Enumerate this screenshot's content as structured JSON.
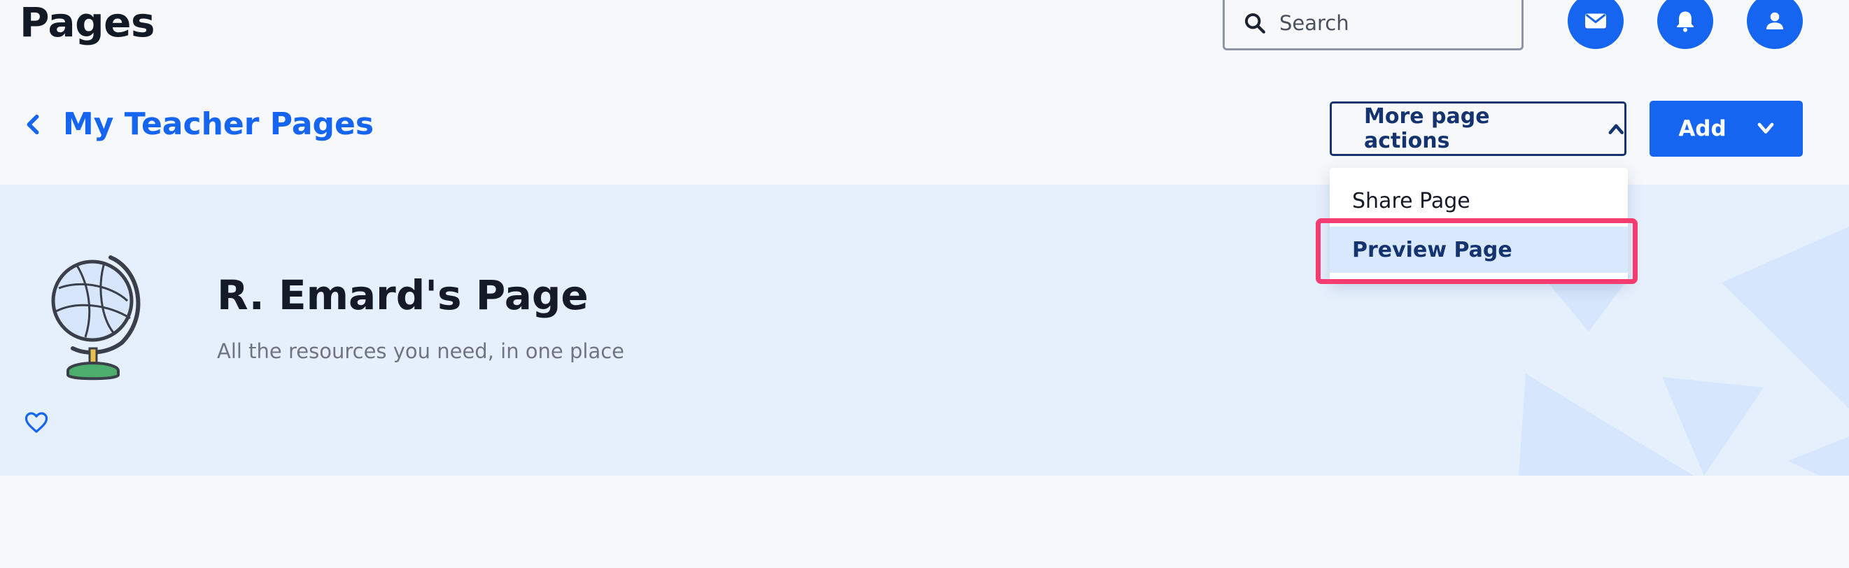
{
  "header": {
    "title": "Pages",
    "search": {
      "placeholder": "Search",
      "icon": "search-icon"
    },
    "actions": [
      {
        "name": "mail-button",
        "icon": "mail-icon"
      },
      {
        "name": "notifications-button",
        "icon": "bell-icon"
      },
      {
        "name": "profile-button",
        "icon": "user-icon"
      }
    ]
  },
  "nav": {
    "back_label": "My Teacher Pages",
    "more_actions_label": "More page actions",
    "add_label": "Add"
  },
  "dropdown": {
    "items": [
      {
        "label": "Share Page"
      },
      {
        "label": "Preview Page"
      }
    ]
  },
  "banner": {
    "heading": "R. Emard's Page",
    "subtitle": "All the resources you need, in one place"
  },
  "colors": {
    "accent": "#1565f0",
    "navy": "#14336f",
    "highlight": "#f43c71",
    "banner_bg": "#e6f0fd",
    "page_bg": "#f6f8fa"
  }
}
